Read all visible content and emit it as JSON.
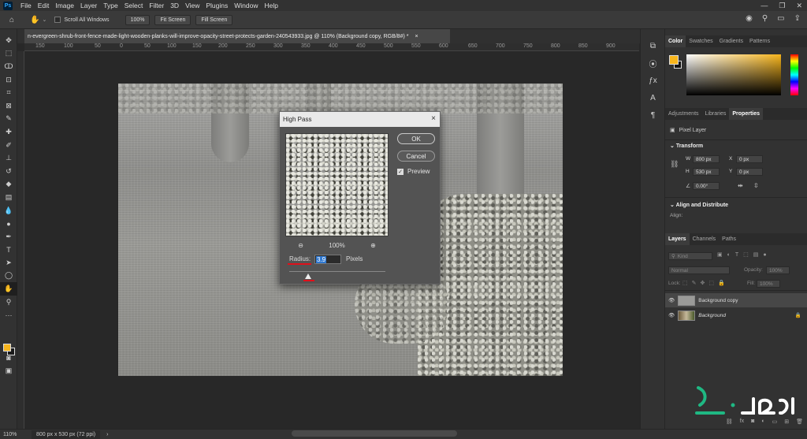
{
  "menubar": {
    "logo": "Ps",
    "items": [
      "File",
      "Edit",
      "Image",
      "Layer",
      "Type",
      "Select",
      "Filter",
      "3D",
      "View",
      "Plugins",
      "Window",
      "Help"
    ]
  },
  "options": {
    "scroll_all": "Scroll All Windows",
    "btn_zoom": "100%",
    "btn_fit": "Fit Screen",
    "btn_fill": "Fill Screen"
  },
  "document": {
    "tab_title": "n-evergreen-shrub-front-fence-made-light-wooden-planks-will-improve-opacity-street-protects-garden-240543933.jpg @ 110% (Background copy, RGB/8#) *",
    "tab_close": "×"
  },
  "ruler": {
    "ticks": [
      "150",
      "100",
      "50",
      "0",
      "50",
      "100",
      "150",
      "200",
      "250",
      "300",
      "350",
      "400",
      "450",
      "500",
      "550",
      "600",
      "650",
      "700",
      "750",
      "800",
      "850",
      "900"
    ]
  },
  "dialog": {
    "title": "High Pass",
    "close": "×",
    "ok": "OK",
    "cancel": "Cancel",
    "preview_label": "Preview",
    "zoom_out": "⊖",
    "zoom_level": "100%",
    "zoom_in": "⊕",
    "radius_label": "Radius:",
    "radius_value": "3.9",
    "units": "Pixels"
  },
  "status": {
    "zoom": "110%",
    "doc_size": "800 px x 530 px (72 ppi)"
  },
  "color_panel": {
    "tabs": [
      "Color",
      "Swatches",
      "Gradients",
      "Patterns"
    ],
    "fg": "#f7b51c",
    "bg": "#111111"
  },
  "props_panel": {
    "tabs": [
      "Adjustments",
      "Libraries",
      "Properties"
    ],
    "layer_kind": "Pixel Layer",
    "transform_title": "Transform",
    "w_label": "W",
    "w_value": "800 px",
    "h_label": "H",
    "h_value": "530 px",
    "x_label": "X",
    "x_value": "0 px",
    "y_label": "Y",
    "y_value": "0 px",
    "angle": "0.00°",
    "align_title": "Align and Distribute",
    "align_label": "Align:"
  },
  "layers_panel": {
    "tabs": [
      "Layers",
      "Channels",
      "Paths"
    ],
    "kind": "Kind",
    "blend": "Normal",
    "opacity_label": "Opacity:",
    "opacity_value": "100%",
    "lock_label": "Lock:",
    "fill_label": "Fill:",
    "fill_value": "100%",
    "layers": [
      {
        "name": "Background copy",
        "selected": true,
        "italic": false
      },
      {
        "name": "Background",
        "selected": false,
        "italic": true
      }
    ]
  }
}
